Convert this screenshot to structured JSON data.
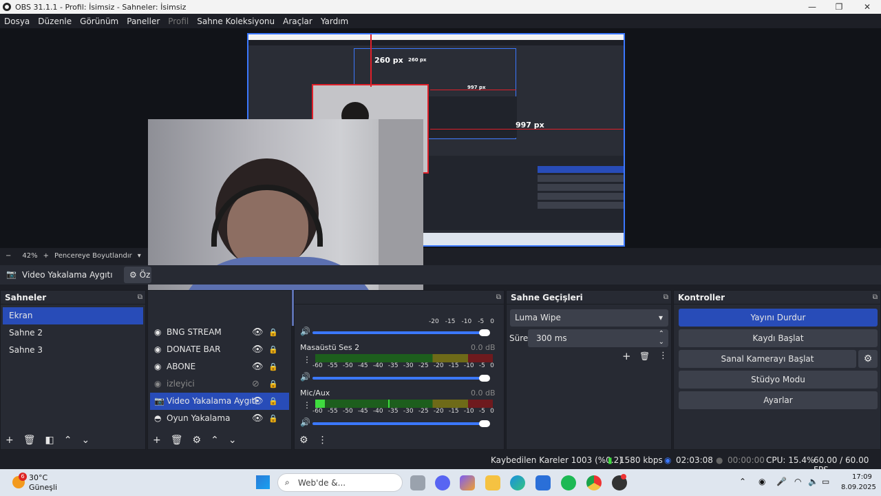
{
  "window": {
    "title": "OBS 31.1.1 - Profil: İsimsiz - Sahneler: İsimsiz",
    "minimize": "—",
    "maximize": "❐",
    "close": "✕"
  },
  "menu": [
    "Dosya",
    "Düzenle",
    "Görünüm",
    "Paneller",
    "Profil",
    "Sahne Koleksiyonu",
    "Araçlar",
    "Yardım"
  ],
  "preview": {
    "label_260": "260 px",
    "label_997": "997 px",
    "inner_label_260": "260 px",
    "inner_label_997": "997 px"
  },
  "zoom": {
    "minus": "−",
    "value": "42%",
    "plus": "+",
    "mode": "Pencereye Boyutlandır"
  },
  "source_bar": {
    "selected_source": "Video Yakalama Aygıtı",
    "filters_btn": "Öz"
  },
  "scenes": {
    "title": "Sahneler",
    "items": [
      "Ekran",
      "Sahne 2",
      "Sahne 3"
    ],
    "selected": "Ekran"
  },
  "sources": {
    "items": [
      {
        "name": "BNG STREAM",
        "icon": "browser-icon",
        "visible": true
      },
      {
        "name": "DONATE BAR",
        "icon": "browser-icon",
        "visible": true
      },
      {
        "name": "ABONE",
        "icon": "browser-icon",
        "visible": true
      },
      {
        "name": "izleyici",
        "icon": "browser-icon",
        "visible": false
      },
      {
        "name": "Video Yakalama Aygıtı",
        "icon": "camera-icon",
        "visible": true,
        "selected": true
      },
      {
        "name": "Oyun Yakalama",
        "icon": "gamepad-icon",
        "visible": true
      }
    ]
  },
  "mixer": {
    "scale": [
      "-60",
      "-55",
      "-50",
      "-45",
      "-40",
      "-35",
      "-30",
      "-25",
      "-20",
      "-15",
      "-10",
      "-5",
      "0"
    ],
    "top_scale": [
      "-20",
      "-15",
      "-10",
      "-5",
      "0"
    ],
    "channels": [
      {
        "name": "Masaüstü Ses 2",
        "db": "0.0 dB"
      },
      {
        "name": "Mic/Aux",
        "db": "0.0 dB"
      }
    ]
  },
  "transitions": {
    "title": "Sahne Geçişleri",
    "type": "Luma Wipe",
    "duration_label": "Süre",
    "duration": "300 ms"
  },
  "controls": {
    "title": "Kontroller",
    "buttons": [
      "Yayını Durdur",
      "Kaydı Başlat",
      "Sanal Kamerayı Başlat",
      "Stüdyo Modu",
      "Ayarlar"
    ]
  },
  "status": {
    "dropped": "Kaybedilen Kareler 1003 (%0.2)",
    "bitrate": "1580 kbps",
    "stream_time": "02:03:08",
    "rec_time": "00:00:00",
    "cpu": "CPU: 15.4%",
    "fps": "60.00 / 60.00 FPS"
  },
  "taskbar": {
    "weather_temp": "30°C",
    "weather_desc": "Güneşli",
    "weather_badge": "6",
    "search_placeholder": "Web'de &...",
    "time": "17:09",
    "date": "8.09.2025"
  },
  "colors": {
    "accent": "#284cb8",
    "selection_border": "#3b78ff",
    "guide_red": "#e0202a",
    "panel": "#272a33",
    "bg": "#1d1f26"
  }
}
